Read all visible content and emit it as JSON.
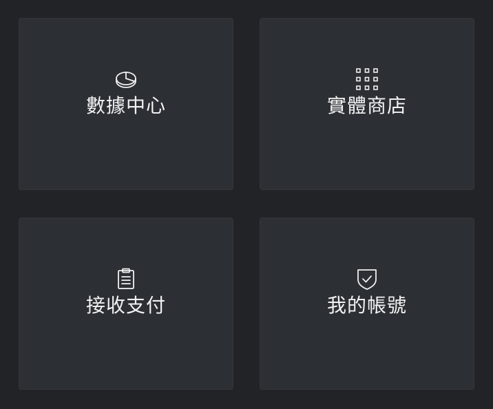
{
  "tiles": [
    {
      "label": "數據中心",
      "icon": "pie-chart-icon"
    },
    {
      "label": "實體商店",
      "icon": "grid-icon"
    },
    {
      "label": "接收支付",
      "icon": "clipboard-icon"
    },
    {
      "label": "我的帳號",
      "icon": "shield-check-icon"
    }
  ],
  "colors": {
    "background": "#212327",
    "tile": "#2c2f34",
    "text": "#f2f2f2"
  }
}
